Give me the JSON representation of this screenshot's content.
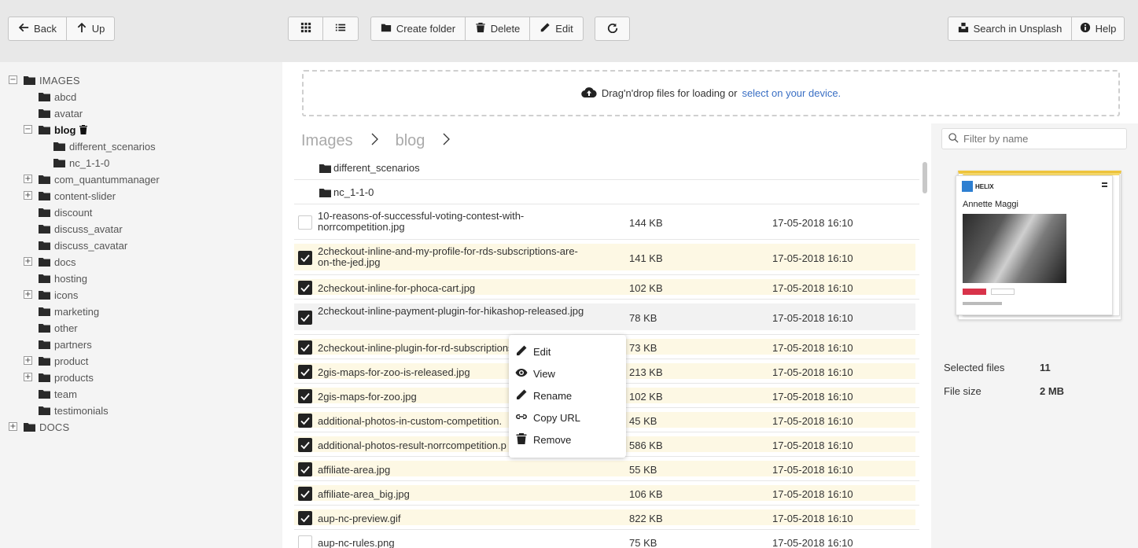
{
  "toolbar": {
    "back": "Back",
    "up": "Up",
    "create_folder": "Create folder",
    "delete": "Delete",
    "edit": "Edit",
    "search_unsplash": "Search in Unsplash",
    "help": "Help"
  },
  "tree": {
    "images_root": "IMAGES",
    "items": [
      "abcd",
      "avatar",
      "blog",
      "different_scenarios",
      "nc_1-1-0",
      "com_quantummanager",
      "content-slider",
      "discount",
      "discuss_avatar",
      "discuss_cavatar",
      "docs",
      "hosting",
      "icons",
      "marketing",
      "other",
      "partners",
      "product",
      "products",
      "team",
      "testimonials"
    ],
    "docs_root": "DOCS"
  },
  "dropzone": {
    "text": "Drag'n'drop files for loading or",
    "link": "select on your device."
  },
  "breadcrumb": [
    "Images",
    "blog"
  ],
  "folders": [
    "different_scenarios",
    "nc_1-1-0"
  ],
  "files": [
    {
      "name": "10-reasons-of-successful-voting-contest-with-norrcompetition.jpg",
      "size": "144 KB",
      "date": "17-05-2018 16:10",
      "checked": false
    },
    {
      "name": "2checkout-inline-and-my-profile-for-rds-subscriptions-are-on-the-jed.jpg",
      "size": "141 KB",
      "date": "17-05-2018 16:10",
      "checked": true
    },
    {
      "name": "2checkout-inline-for-phoca-cart.jpg",
      "size": "102 KB",
      "date": "17-05-2018 16:10",
      "checked": true
    },
    {
      "name": "2checkout-inline-payment-plugin-for-hikashop-released.jpg",
      "size": "78 KB",
      "date": "17-05-2018 16:10",
      "checked": true
    },
    {
      "name": "2checkout-inline-plugin-for-rd-subscriptions",
      "size": "73 KB",
      "date": "17-05-2018 16:10",
      "checked": true
    },
    {
      "name": "2gis-maps-for-zoo-is-released.jpg",
      "size": "213 KB",
      "date": "17-05-2018 16:10",
      "checked": true
    },
    {
      "name": "2gis-maps-for-zoo.jpg",
      "size": "102 KB",
      "date": "17-05-2018 16:10",
      "checked": true
    },
    {
      "name": "additional-photos-in-custom-competition.",
      "size": "45 KB",
      "date": "17-05-2018 16:10",
      "checked": true
    },
    {
      "name": "additional-photos-result-norrcompetition.p",
      "size": "586 KB",
      "date": "17-05-2018 16:10",
      "checked": true
    },
    {
      "name": "affiliate-area.jpg",
      "size": "55 KB",
      "date": "17-05-2018 16:10",
      "checked": true
    },
    {
      "name": "affiliate-area_big.jpg",
      "size": "106 KB",
      "date": "17-05-2018 16:10",
      "checked": true
    },
    {
      "name": "aup-nc-preview.gif",
      "size": "822 KB",
      "date": "17-05-2018 16:10",
      "checked": true
    },
    {
      "name": "aup-nc-rules.png",
      "size": "75 KB",
      "date": "17-05-2018 16:10",
      "checked": false
    }
  ],
  "context_menu": [
    "Edit",
    "View",
    "Rename",
    "Copy URL",
    "Remove"
  ],
  "panel": {
    "filter_placeholder": "Filter by name",
    "preview_brand": "HELIX",
    "preview_person": "Annette Maggi",
    "selected_label": "Selected files",
    "selected_value": "11",
    "size_label": "File size",
    "size_value": "2 MB"
  },
  "colors": {
    "selected_row": "#fdf8e4",
    "link": "#3a6fc4",
    "toolbar_bg": "#e8e8e8"
  }
}
